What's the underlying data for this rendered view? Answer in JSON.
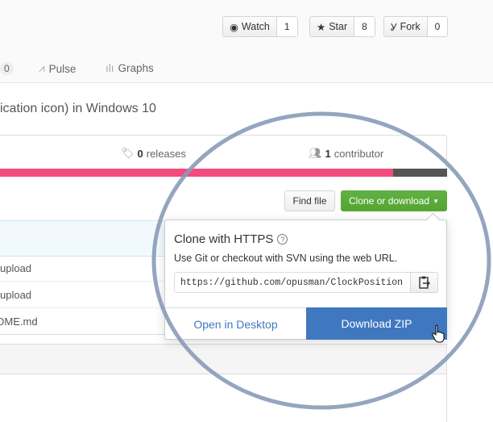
{
  "repo_actions": {
    "watch": {
      "label": "Watch",
      "count": "1",
      "icon": "eye-icon"
    },
    "star": {
      "label": "Star",
      "count": "8",
      "icon": "star-icon"
    },
    "fork": {
      "label": "Fork",
      "count": "0",
      "icon": "fork-icon"
    }
  },
  "tabs": {
    "counter": "0",
    "pulse": "Pulse",
    "graphs": "Graphs"
  },
  "description": "ication icon) in Windows 10",
  "summary": {
    "releases_count": "0",
    "releases_label": "releases",
    "contributors_count": "1",
    "contributors_label": "contributor"
  },
  "language_bar": {
    "colors": [
      "#f34b7d",
      "#555555"
    ],
    "fractions": [
      0.88,
      0.12
    ]
  },
  "toolbar": {
    "find_file": "Find file",
    "clone": "Clone or download"
  },
  "files": [
    {
      "name": "upload"
    },
    {
      "name": "upload"
    },
    {
      "name": "DME.md"
    }
  ],
  "clone_dropdown": {
    "title": "Clone with HTTPS",
    "help": "?",
    "subtitle": "Use Git or checkout with SVN using the web URL.",
    "url": "https://github.com/opusman/ClockPosition",
    "open_desktop": "Open in Desktop",
    "download_zip": "Download ZIP"
  },
  "colors": {
    "green": "#55a532",
    "blue": "#4078c0",
    "highlight_ring": "#8a9bb8"
  }
}
